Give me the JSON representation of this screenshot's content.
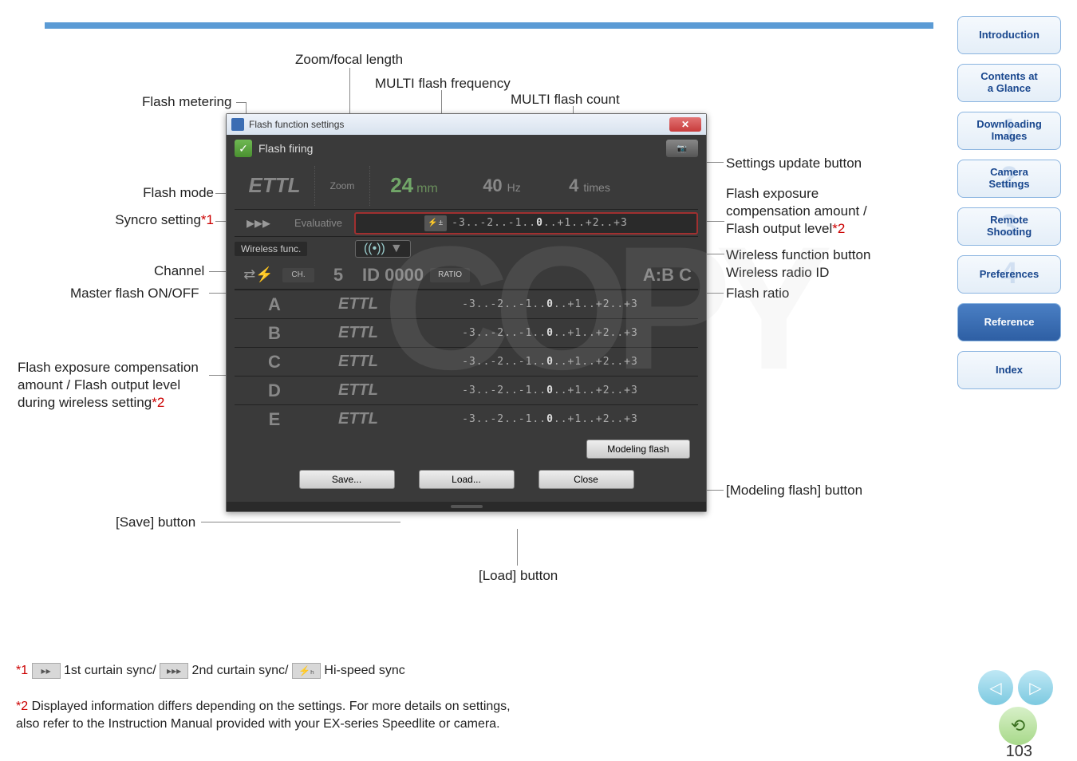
{
  "page_number": "103",
  "sidebar": [
    {
      "label": "Introduction",
      "num": ""
    },
    {
      "label": "Contents at\na Glance",
      "num": ""
    },
    {
      "label": "Downloading\nImages",
      "num": "1"
    },
    {
      "label": "Camera\nSettings",
      "num": "2"
    },
    {
      "label": "Remote\nShooting",
      "num": "3"
    },
    {
      "label": "Preferences",
      "num": "4"
    },
    {
      "label": "Reference",
      "num": ""
    },
    {
      "label": "Index",
      "num": ""
    }
  ],
  "callouts": {
    "zoom_focal": "Zoom/focal length",
    "multi_freq": "MULTI flash frequency",
    "multi_count": "MULTI flash count",
    "flash_metering": "Flash metering",
    "flash_mode": "Flash mode",
    "syncro": "Syncro setting",
    "channel": "Channel",
    "master": "Master flash ON/OFF",
    "fec_wireless": "Flash exposure compensation\namount / Flash output level\nduring wireless setting",
    "save_btn": "[Save] button",
    "load_btn": "[Load] button",
    "settings_update": "Settings update button",
    "flash_exposure": "Flash exposure\ncompensation amount /\nFlash output level",
    "wireless_func": "Wireless function button",
    "wireless_id": "Wireless radio ID",
    "flash_ratio": "Flash ratio",
    "modeling_btn": "[Modeling flash] button",
    "star1": "*1",
    "star2": "*2"
  },
  "dialog": {
    "title": "Flash function settings",
    "flash_firing": "Flash firing",
    "ettl": "ETTL",
    "zoom_label": "Zoom",
    "zoom_val": "24",
    "zoom_unit": "mm",
    "hz_val": "40",
    "hz_unit": "Hz",
    "times_val": "4",
    "times_unit": "times",
    "evaluative": "Evaluative",
    "scale": "-3..-2..-1..0..+1..+2..+3",
    "wireless_func": "Wireless func.",
    "ch_badge": "CH.",
    "ch_val": "5",
    "id_label": "ID",
    "id_val": "0000",
    "ratio_badge": "RATIO",
    "abc": "A:B C",
    "groups": [
      "A",
      "B",
      "C",
      "D",
      "E"
    ],
    "modeling": "Modeling flash",
    "save": "Save...",
    "load": "Load...",
    "close": "Close"
  },
  "footnotes": {
    "f1_pre": "*1",
    "f1_a": "1st curtain sync/",
    "f1_b": "2nd curtain sync/",
    "f1_c": "Hi-speed sync",
    "f2_pre": "*2",
    "f2": "Displayed information differs depending on the settings. For more details on settings,\nalso refer to the Instruction Manual provided with your EX-series Speedlite or camera."
  }
}
